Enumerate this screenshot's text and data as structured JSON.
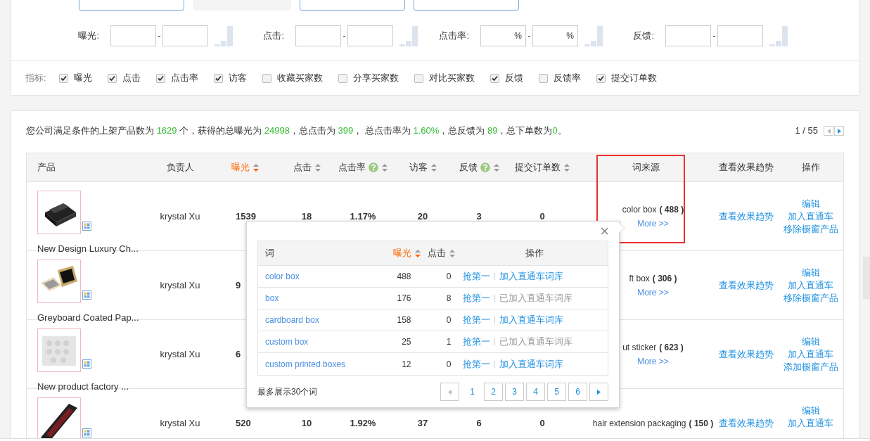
{
  "filter_buttons": [
    {
      "disabled": false
    },
    {
      "disabled": true
    },
    {
      "disabled": false
    },
    {
      "disabled": false
    }
  ],
  "ranges": [
    {
      "label": "曝光:",
      "separator": "-"
    },
    {
      "label": "点击:",
      "separator": "-"
    },
    {
      "label": "点击率:",
      "unit": "%",
      "separator": "-"
    },
    {
      "label": "反馈:",
      "separator": "-"
    }
  ],
  "metrics_label": "指标:",
  "metrics": [
    {
      "label": "曝光",
      "checked": true
    },
    {
      "label": "点击",
      "checked": true
    },
    {
      "label": "点击率",
      "checked": true
    },
    {
      "label": "访客",
      "checked": true
    },
    {
      "label": "收藏买家数",
      "checked": false
    },
    {
      "label": "分享买家数",
      "checked": false
    },
    {
      "label": "对比买家数",
      "checked": false
    },
    {
      "label": "反馈",
      "checked": true
    },
    {
      "label": "反馈率",
      "checked": false
    },
    {
      "label": "提交订单数",
      "checked": true
    }
  ],
  "summary": [
    {
      "text": "您公司满足条件的上架产品数为 ",
      "kind": "plain"
    },
    {
      "text": "1629",
      "kind": "value"
    },
    {
      "text": " 个，获得的总曝光为 ",
      "kind": "plain"
    },
    {
      "text": "24998",
      "kind": "value"
    },
    {
      "text": "，总点击为 ",
      "kind": "plain"
    },
    {
      "text": "399",
      "kind": "value"
    },
    {
      "text": "， 总点击率为 ",
      "kind": "plain"
    },
    {
      "text": "1.60%",
      "kind": "value"
    },
    {
      "text": "，总反馈为 ",
      "kind": "plain"
    },
    {
      "text": "89",
      "kind": "value"
    },
    {
      "text": "，总下单数为",
      "kind": "plain"
    },
    {
      "text": "0",
      "kind": "value"
    },
    {
      "text": "。",
      "kind": "plain"
    }
  ],
  "pager": "1 / 55",
  "columns": [
    {
      "label": "产品",
      "sortable": false,
      "help": false,
      "active": false
    },
    {
      "label": "负责人",
      "sortable": false,
      "help": false,
      "active": false
    },
    {
      "label": "曝光",
      "sortable": true,
      "help": false,
      "active": true
    },
    {
      "label": "点击",
      "sortable": true,
      "help": false,
      "active": false
    },
    {
      "label": "点击率",
      "sortable": true,
      "help": true,
      "active": false
    },
    {
      "label": "访客",
      "sortable": true,
      "help": false,
      "active": false
    },
    {
      "label": "反馈",
      "sortable": true,
      "help": true,
      "active": false
    },
    {
      "label": "提交订单数",
      "sortable": true,
      "help": false,
      "active": false
    },
    {
      "label": "词来源",
      "sortable": false,
      "help": false,
      "active": false
    },
    {
      "label": "查看效果趋势",
      "sortable": false,
      "help": false,
      "active": false
    },
    {
      "label": "操作",
      "sortable": false,
      "help": false,
      "active": false
    }
  ],
  "rows": [
    {
      "product": "New Design Luxury Ch...",
      "kind": "dark-box",
      "owner": "krystal Xu",
      "exposure": "1539",
      "clicks": "18",
      "ctr": "1.17%",
      "visitors": "20",
      "feedback": "3",
      "orders": "0",
      "keyword": "color box",
      "keyword_count": "( 488 )",
      "more": "More >>",
      "trend": "查看效果趋势",
      "actions": [
        "编辑",
        "加入直通车",
        "移除橱窗产品"
      ]
    },
    {
      "product": "Greyboard Coated Pap...",
      "kind": "kraft-box",
      "owner": "krystal Xu",
      "exposure": "9",
      "keyword": "ft box",
      "keyword_count": "( 306 )",
      "more": "More >>",
      "trend": "查看效果趋势",
      "actions": [
        "编辑",
        "加入直通车",
        "移除橱窗产品"
      ]
    },
    {
      "product": "New product factory ...",
      "kind": "sticker-sheet",
      "owner": "krystal Xu",
      "exposure": "6",
      "keyword": "ut sticker",
      "keyword_count": "( 623 )",
      "more": "More >>",
      "trend": "查看效果趋势",
      "actions": [
        "编辑",
        "加入直通车",
        "添加橱窗产品"
      ]
    },
    {
      "kind": "long-box",
      "owner": "krystal Xu",
      "exposure": "520",
      "clicks": "10",
      "ctr": "1.92%",
      "visitors": "37",
      "feedback": "6",
      "orders": "0",
      "keyword": "hair extension packaging",
      "keyword_count": "( 150 )",
      "trend": "查看效果趋势",
      "actions": [
        "编辑",
        "加入直通车"
      ]
    }
  ],
  "popover": {
    "close": "×",
    "columns": [
      {
        "label": "词",
        "sortable": false,
        "active": false
      },
      {
        "label": "曝光",
        "sortable": true,
        "active": true
      },
      {
        "label": "点击",
        "sortable": true,
        "active": false
      },
      {
        "label": "操作",
        "sortable": false,
        "active": false
      }
    ],
    "rows": [
      {
        "word": "color box",
        "exposure": "488",
        "clicks": "0",
        "grab": "抢第一",
        "add": "加入直通车词库",
        "added": false
      },
      {
        "word": "box",
        "exposure": "176",
        "clicks": "8",
        "grab": "抢第一",
        "add": "已加入直通车词库",
        "added": true
      },
      {
        "word": "cardboard box",
        "exposure": "158",
        "clicks": "0",
        "grab": "抢第一",
        "add": "加入直通车词库",
        "added": false
      },
      {
        "word": "custom box",
        "exposure": "25",
        "clicks": "1",
        "grab": "抢第一",
        "add": "已加入直通车词库",
        "added": true
      },
      {
        "word": "custom printed boxes",
        "exposure": "12",
        "clicks": "0",
        "grab": "抢第一",
        "add": "加入直通车词库",
        "added": false
      }
    ],
    "footer": "最多展示30个词",
    "pages": [
      {
        "label": "1",
        "selected": true
      },
      {
        "label": "2",
        "selected": false
      },
      {
        "label": "3",
        "selected": false
      },
      {
        "label": "4",
        "selected": false
      },
      {
        "label": "5",
        "selected": false
      },
      {
        "label": "6",
        "selected": false
      }
    ]
  }
}
